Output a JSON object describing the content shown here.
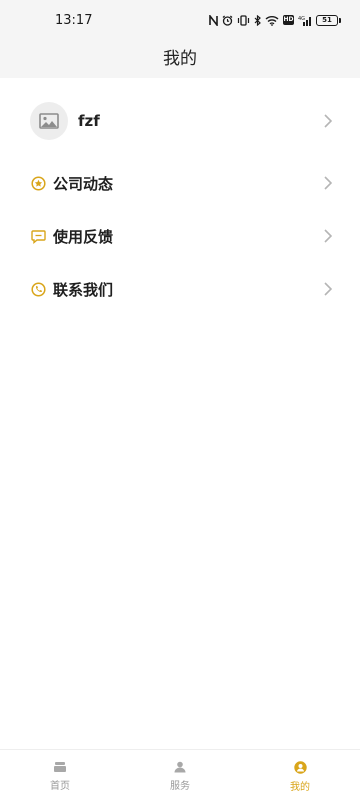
{
  "status_bar": {
    "time": "13:17",
    "battery_level": "51"
  },
  "header": {
    "title": "我的"
  },
  "profile": {
    "name": "fzf"
  },
  "menu": [
    {
      "label": "公司动态",
      "icon": "star-circle-icon"
    },
    {
      "label": "使用反馈",
      "icon": "chat-bubble-icon"
    },
    {
      "label": "联系我们",
      "icon": "phone-circle-icon"
    }
  ],
  "tabs": [
    {
      "label": "首页",
      "icon": "home-icon",
      "active": false
    },
    {
      "label": "服务",
      "icon": "service-icon",
      "active": false
    },
    {
      "label": "我的",
      "icon": "profile-icon",
      "active": true
    }
  ],
  "colors": {
    "accent": "#d9a51a",
    "inactive": "#9a9a9a",
    "header_bg": "#f5f5f5"
  }
}
